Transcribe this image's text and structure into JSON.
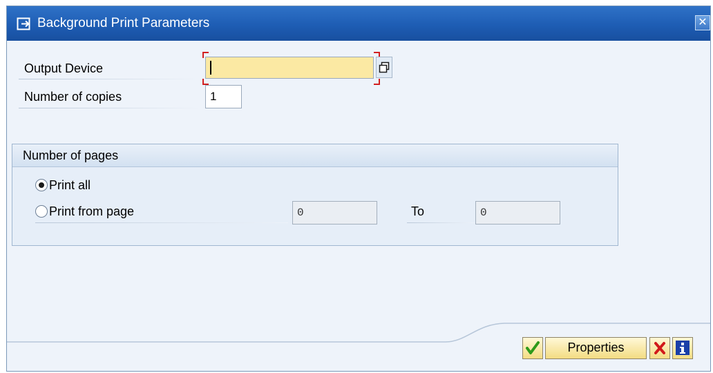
{
  "dialog": {
    "title": "Background Print Parameters",
    "close_label": "✕"
  },
  "form": {
    "output_device": {
      "label": "Output Device",
      "value": ""
    },
    "copies": {
      "label": "Number of copies",
      "value": "1"
    }
  },
  "pages_group": {
    "title": "Number of pages",
    "print_all_label": "Print all",
    "print_all_selected": true,
    "print_from_label": "Print from page",
    "from_value": "0",
    "to_label": "To",
    "to_value": "0"
  },
  "footer": {
    "properties_label": "Properties",
    "buttons": [
      "continue-check-icon",
      "properties",
      "cancel-x-icon",
      "info-icon"
    ]
  },
  "colors": {
    "title_bar": "#1e5db4",
    "required_field": "#fbe9a3",
    "focus_marker": "#d21f1f",
    "continue_green": "#2e9a1a",
    "cancel_red": "#d11a1a",
    "info_blue": "#1a3fa8"
  }
}
